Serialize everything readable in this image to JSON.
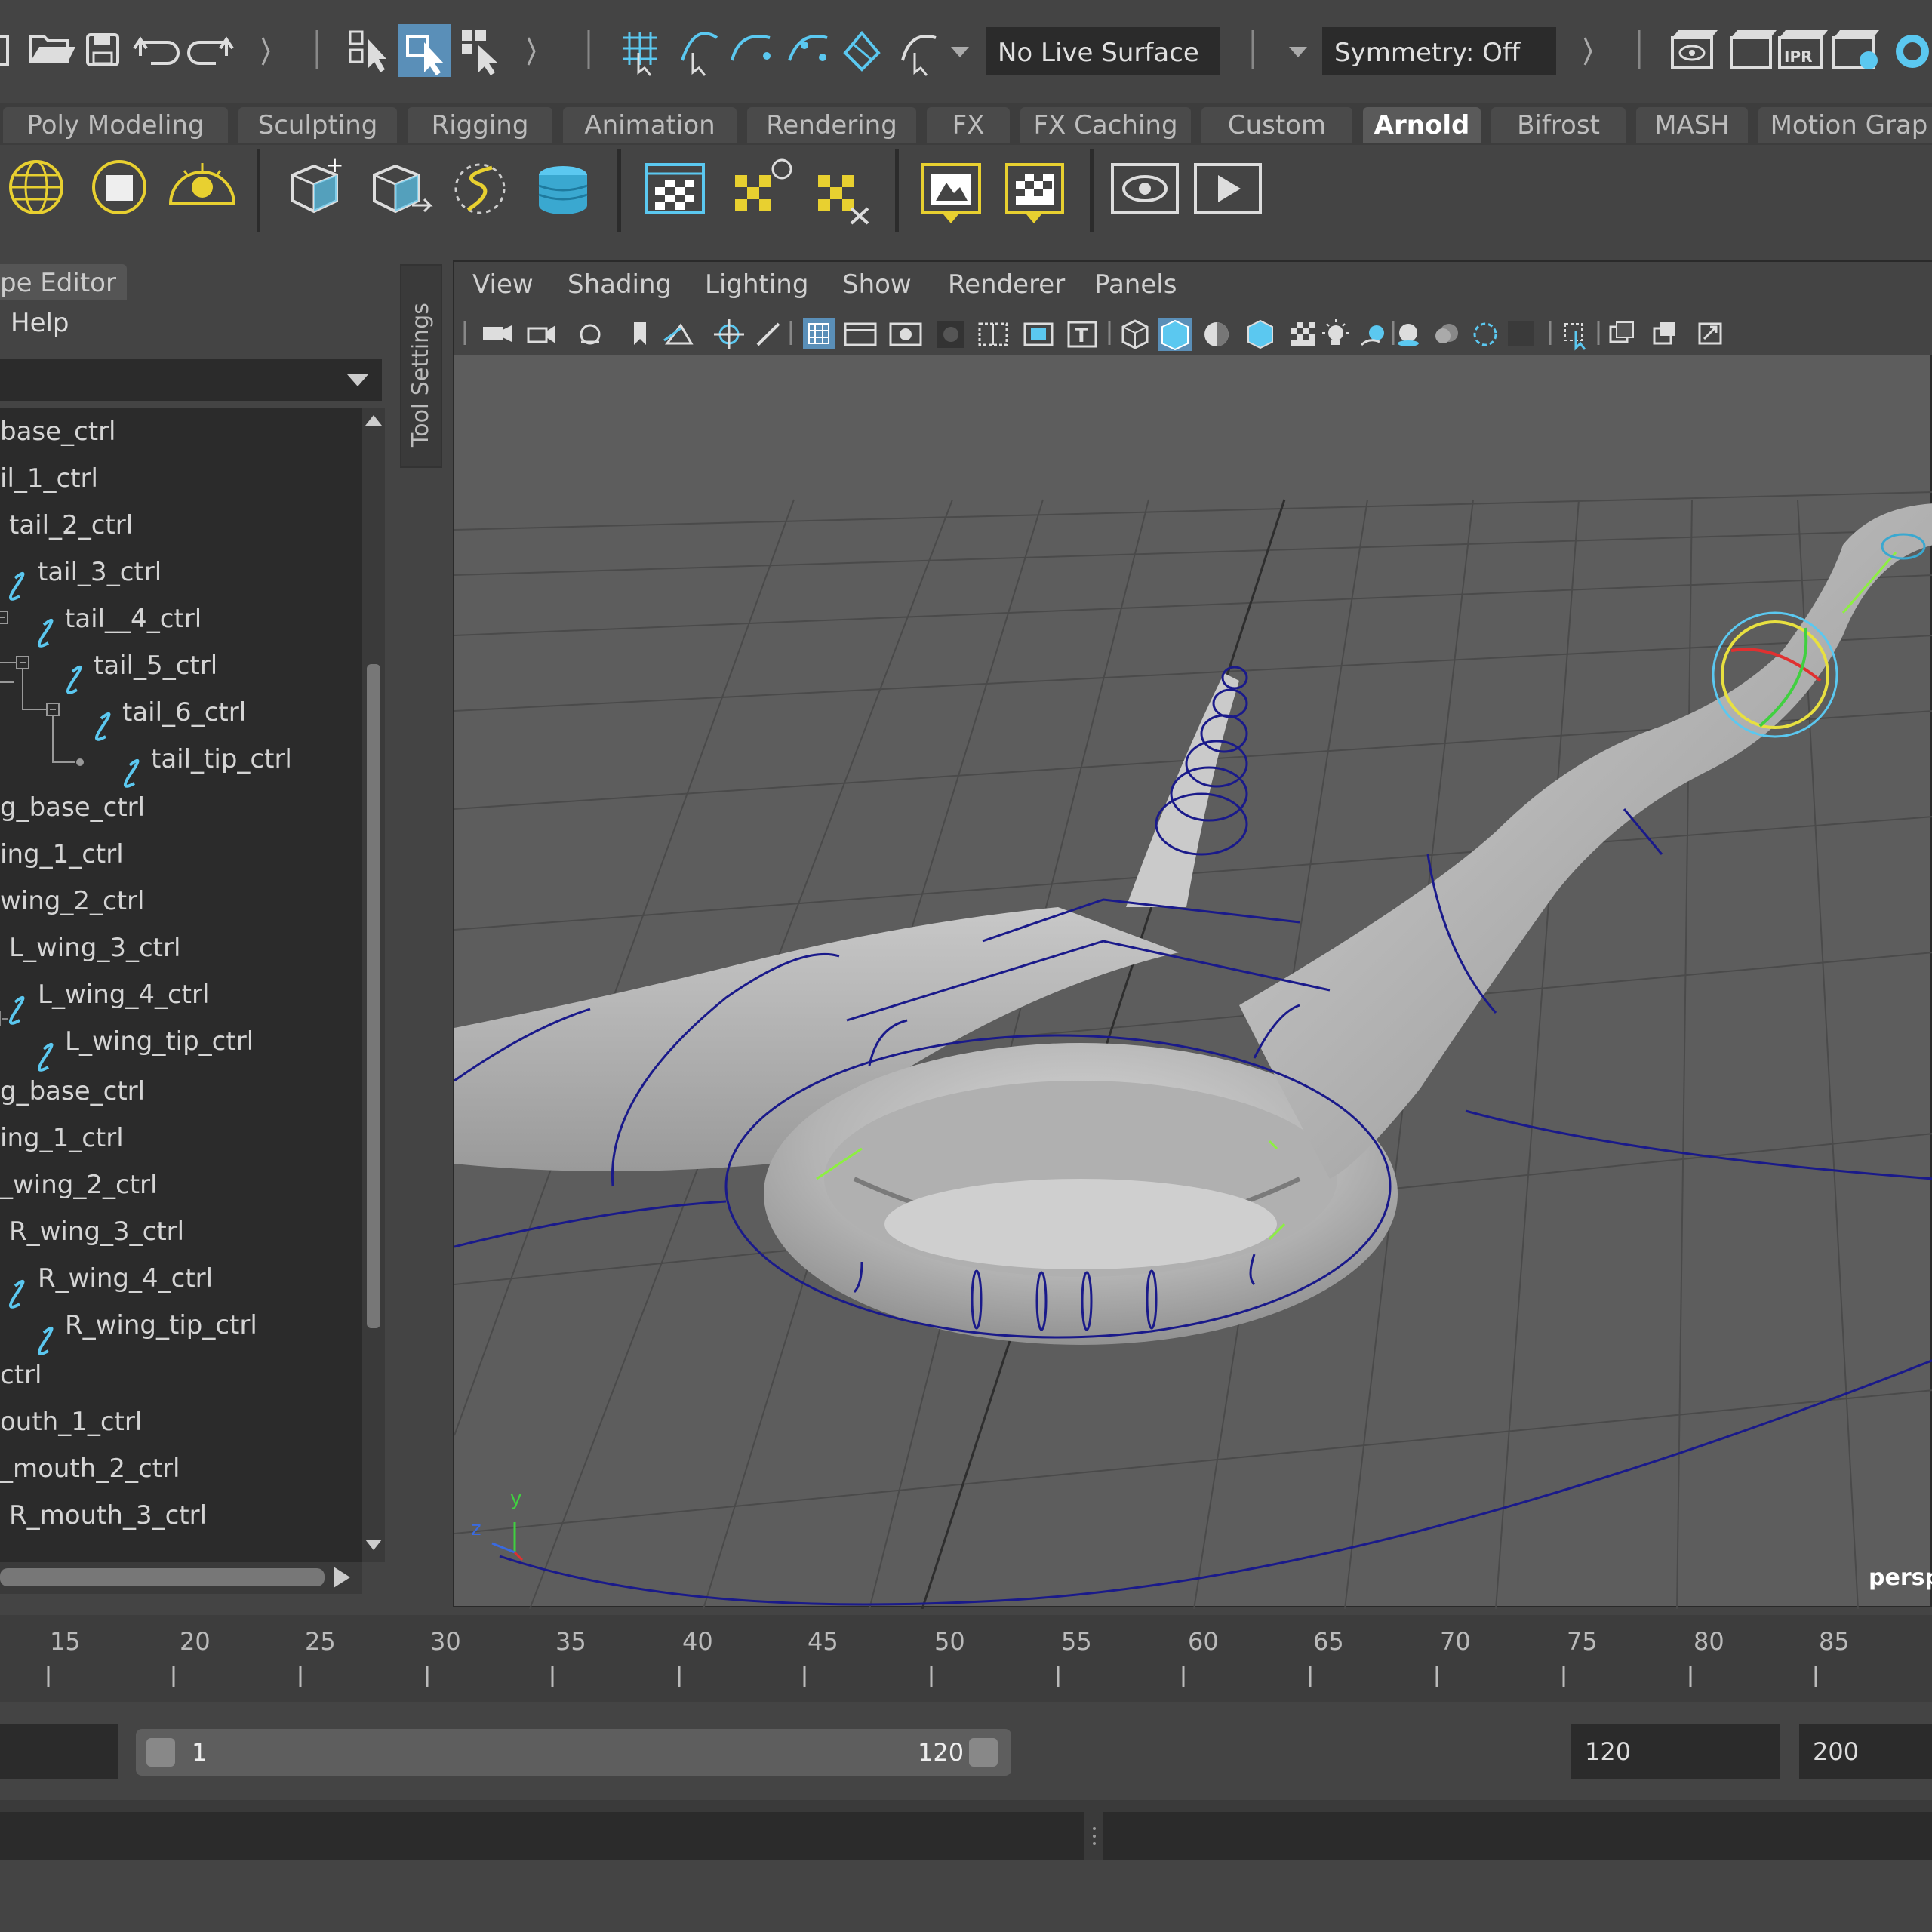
{
  "status_line": {
    "live_surface": "No Live Surface",
    "symmetry": "Symmetry: Off"
  },
  "shelf_tabs": [
    {
      "label": "Poly Modeling"
    },
    {
      "label": "Sculpting"
    },
    {
      "label": "Rigging"
    },
    {
      "label": "Animation"
    },
    {
      "label": "Rendering"
    },
    {
      "label": "FX"
    },
    {
      "label": "FX Caching"
    },
    {
      "label": "Custom"
    },
    {
      "label": "Arnold",
      "active": true
    },
    {
      "label": "Bifrost"
    },
    {
      "label": "MASH"
    },
    {
      "label": "Motion Grap"
    }
  ],
  "left_panel": {
    "title": "pe Editor",
    "menu_help": "Help",
    "tool_settings": "Tool Settings",
    "items": [
      "base_ctrl",
      "il_1_ctrl",
      "tail_2_ctrl",
      "tail_3_ctrl",
      "tail__4_ctrl",
      "tail_5_ctrl",
      "tail_6_ctrl",
      "tail_tip_ctrl",
      "g_base_ctrl",
      "ing_1_ctrl",
      "wing_2_ctrl",
      "L_wing_3_ctrl",
      "L_wing_4_ctrl",
      "L_wing_tip_ctrl",
      "g_base_ctrl",
      "ing_1_ctrl",
      "_wing_2_ctrl",
      "R_wing_3_ctrl",
      "R_wing_4_ctrl",
      "R_wing_tip_ctrl",
      "ctrl",
      "outh_1_ctrl",
      "_mouth_2_ctrl",
      "R_mouth_3_ctrl"
    ]
  },
  "viewport": {
    "menu": [
      "View",
      "Shading",
      "Lighting",
      "Show",
      "Renderer",
      "Panels"
    ],
    "camera_label": "persp",
    "axis": {
      "y": "y",
      "z": "z"
    }
  },
  "timeline": {
    "ticks": [
      "15",
      "20",
      "25",
      "30",
      "35",
      "40",
      "45",
      "50",
      "55",
      "60",
      "65",
      "70",
      "75",
      "80",
      "85"
    ]
  },
  "range": {
    "start": "1",
    "end": "120",
    "anim_end": "120",
    "anim_max": "200"
  },
  "colors": {
    "accent_blue": "#5bc8f0",
    "active_button": "#5a8fb8",
    "control_curve": "#1a1a8a",
    "arnold_yellow": "#e8d030"
  }
}
